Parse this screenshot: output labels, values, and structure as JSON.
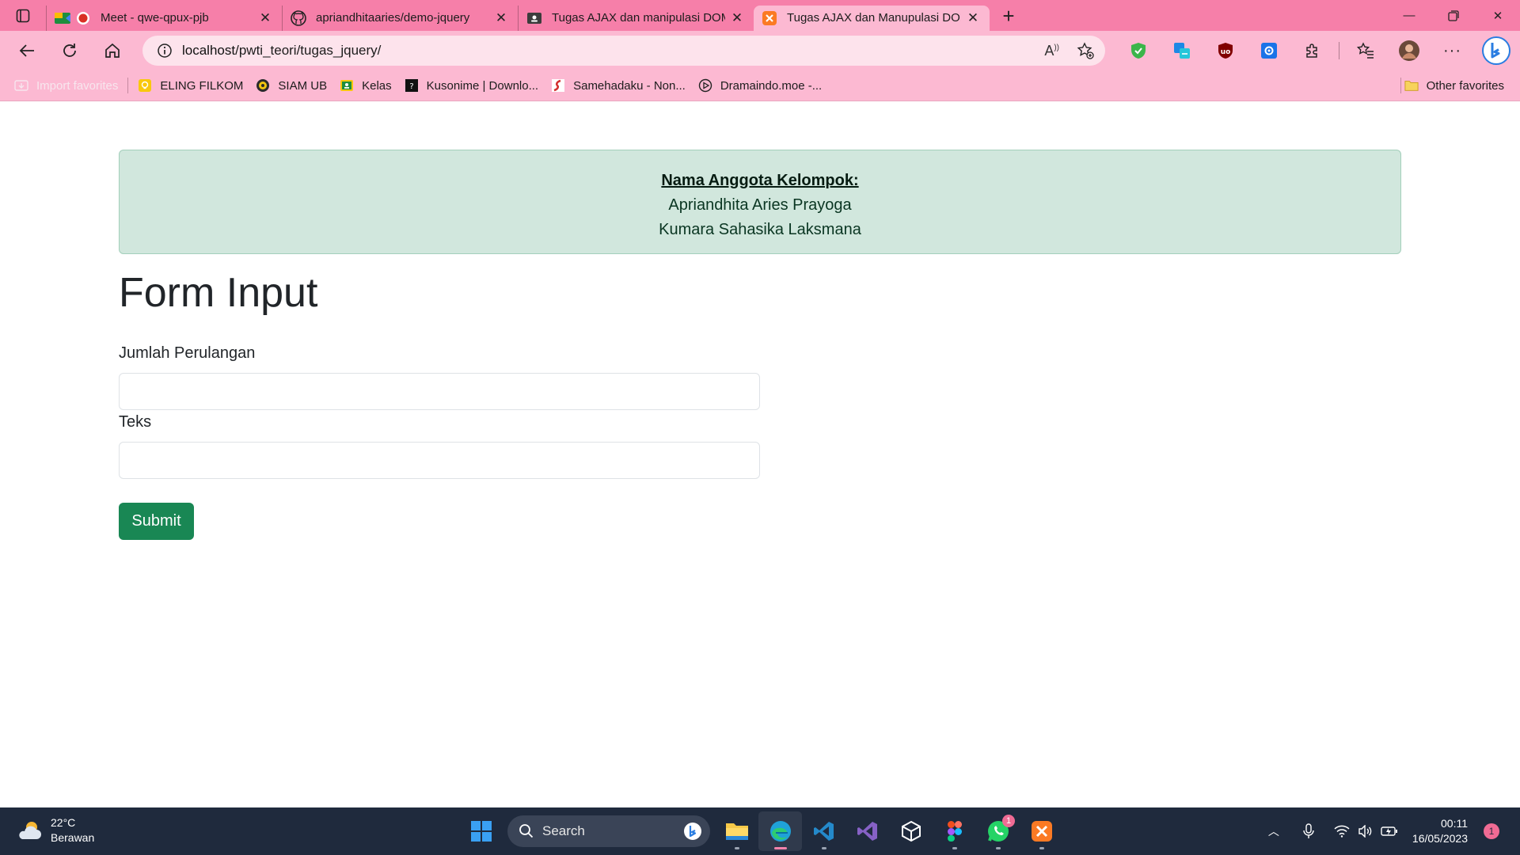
{
  "browser": {
    "tabs": [
      {
        "title": "Meet - qwe-qpux-pjb",
        "active": false
      },
      {
        "title": "apriandhitaaries/demo-jquery",
        "active": false
      },
      {
        "title": "Tugas AJAX dan manipulasi DOM",
        "active": false
      },
      {
        "title": "Tugas AJAX dan Manupulasi DOM",
        "active": true
      }
    ],
    "url_host": "localhost",
    "url_path": "/pwti_teori/tugas_jquery/",
    "favorites": [
      {
        "label": "Import favorites"
      },
      {
        "label": "ELING FILKOM"
      },
      {
        "label": "SIAM UB"
      },
      {
        "label": "Kelas"
      },
      {
        "label": "Kusonime | Downlo..."
      },
      {
        "label": "Samehadaku - Non..."
      },
      {
        "label": "Dramaindo.moe -..."
      }
    ],
    "other_favorites": "Other favorites"
  },
  "page": {
    "alert": {
      "heading": "Nama Anggota Kelompok:",
      "members": [
        "Apriandhita Aries Prayoga",
        "Kumara Sahasika Laksmana"
      ]
    },
    "title": "Form Input",
    "fields": [
      {
        "label": "Jumlah Perulangan",
        "value": ""
      },
      {
        "label": "Teks",
        "value": ""
      }
    ],
    "submit_label": "Submit"
  },
  "taskbar": {
    "weather_temp": "22°C",
    "weather_desc": "Berawan",
    "search_label": "Search",
    "whatsapp_badge": "1",
    "time": "00:11",
    "date": "16/05/2023",
    "notification_count": "1"
  },
  "colors": {
    "tabstrip": "#f67fa9",
    "toolbar": "#fcb9d2",
    "alert_bg": "#d1e7dd",
    "submit_bg": "#198754",
    "taskbar": "#1f2a3d"
  }
}
